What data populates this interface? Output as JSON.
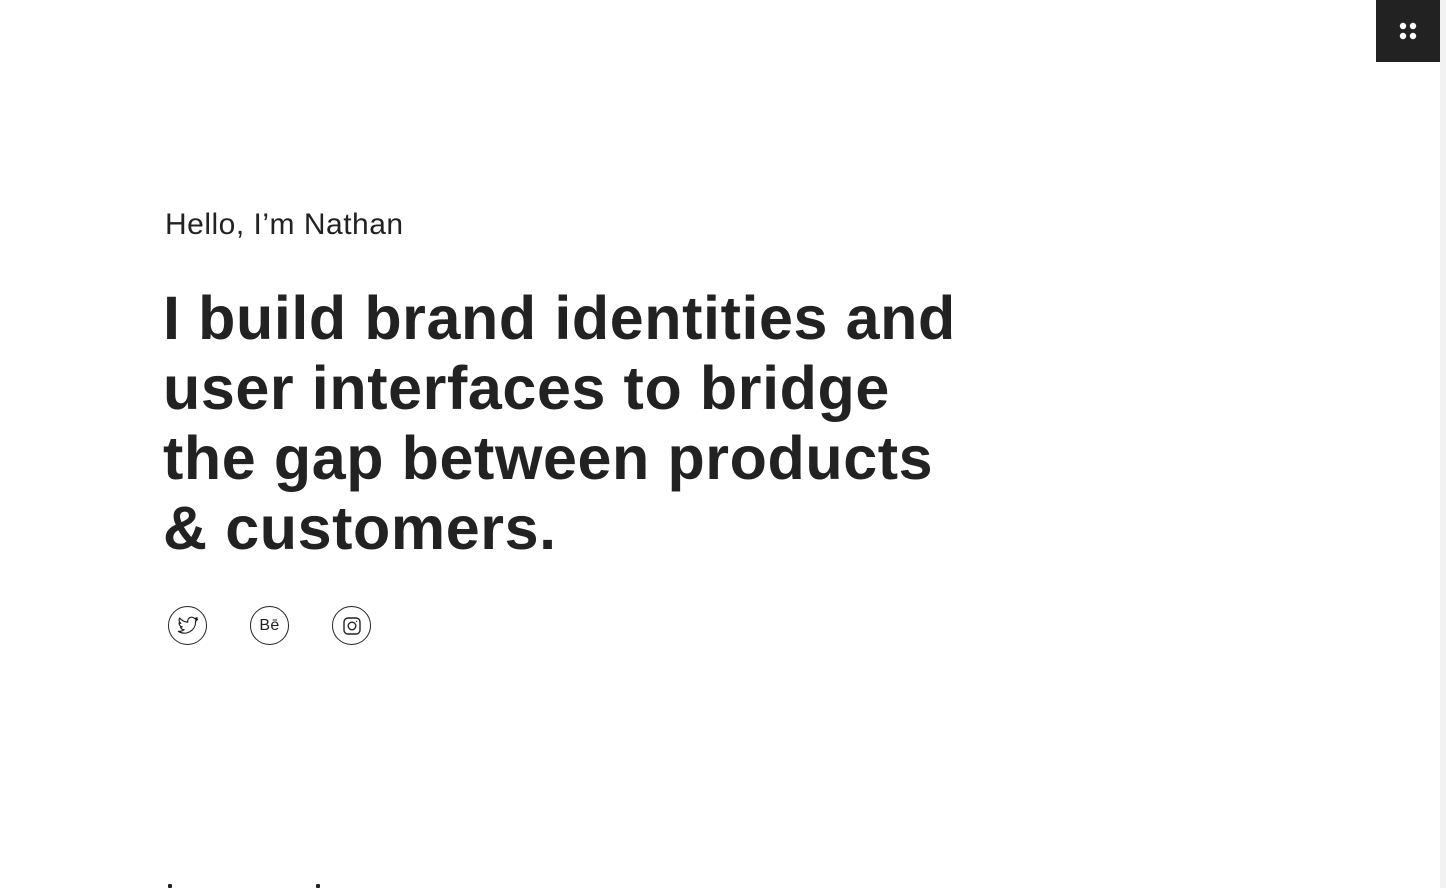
{
  "menu": {
    "icon": "grid-dots-icon"
  },
  "hero": {
    "greeting": "Hello, I’m Nathan",
    "headline_lines": [
      "I build brand identities and",
      "user interfaces to bridge",
      "the gap between products",
      "& customers."
    ]
  },
  "social": [
    {
      "icon": "twitter-icon"
    },
    {
      "icon": "behance-icon",
      "glyph": "Bē"
    },
    {
      "icon": "instagram-icon"
    }
  ],
  "colors": {
    "background": "#ffffff",
    "text": "#222222",
    "menu_background": "#222222",
    "menu_icon": "#ffffff"
  }
}
